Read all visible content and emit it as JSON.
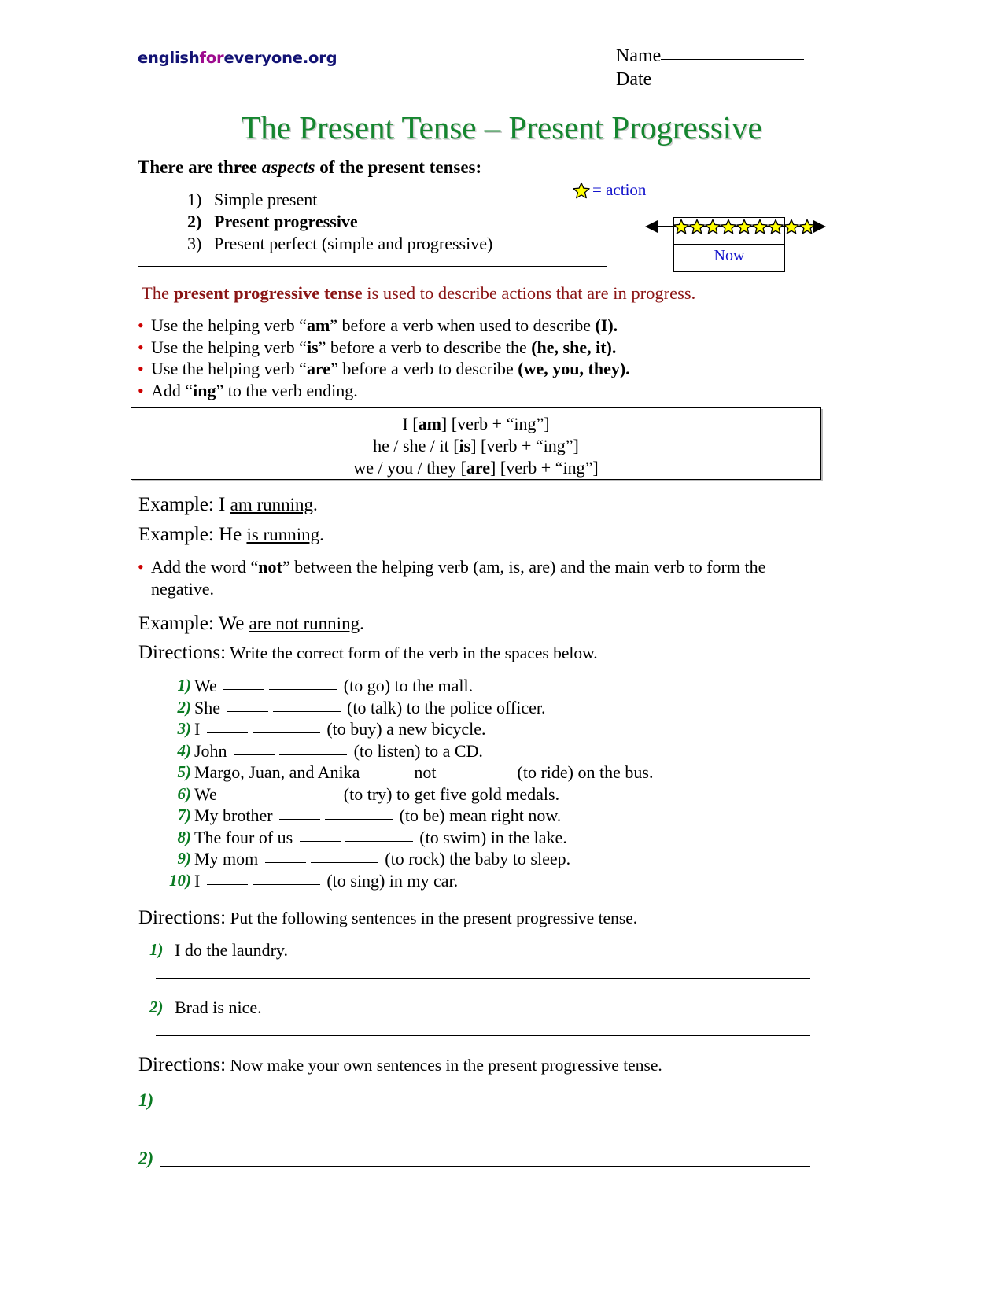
{
  "header": {
    "logo": {
      "part1": "english",
      "part2": "for",
      "part3": "everyone.org"
    },
    "name_label": "Name",
    "date_label": "Date"
  },
  "title": "The Present Tense – Present Progressive",
  "intro": {
    "heading_a": "There are three ",
    "heading_em": "aspects",
    "heading_b": " of the present tenses:",
    "aspects": [
      {
        "num": "1)",
        "label": "Simple present"
      },
      {
        "num": "2)",
        "label": "Present progressive"
      },
      {
        "num": "3)",
        "label": "Present perfect (simple and progressive)"
      }
    ]
  },
  "diagram": {
    "legend_text": "= action",
    "now_label": "Now",
    "star_count": 9,
    "star_color": "#ffff00",
    "legend_color": "#1414cc"
  },
  "rule_sentence": {
    "pre": "The ",
    "bold": "present progressive tense",
    "post": " is used to describe actions that are in progress.",
    "color": "#8a1414"
  },
  "bullets": [
    {
      "pre": "Use the helping verb “",
      "b1": "am",
      "mid": "” before a verb when used to describe ",
      "b2": "(I).",
      "post": ""
    },
    {
      "pre": "Use the helping verb “",
      "b1": "is",
      "mid": "” before a verb to describe the ",
      "b2": "(he, she, it).",
      "post": ""
    },
    {
      "pre": "Use the helping verb “",
      "b1": "are",
      "mid": "” before a verb to describe ",
      "b2": "(we, you, they).",
      "post": ""
    },
    {
      "pre": "Add “",
      "b1": "ing",
      "mid": "” to the verb ending.",
      "b2": "",
      "post": ""
    }
  ],
  "formula": {
    "line1_a": "I  [",
    "line1_b": "am",
    "line1_c": "] [verb + “ing”]",
    "line2_a": "he / she / it  [",
    "line2_b": "is",
    "line2_c": "] [verb + “ing”]",
    "line3_a": "we / you / they  [",
    "line3_b": "are",
    "line3_c": "] [verb + “ing”]"
  },
  "examples": {
    "ex1_lead": "Example: I ",
    "ex1_underline": "am running",
    "ex1_tail": ".",
    "ex2_lead": "Example: He ",
    "ex2_underline": "is running",
    "ex2_tail": ".",
    "ex3_lead": "Example: We ",
    "ex3_underline": "are not running",
    "ex3_tail": "."
  },
  "negative_bullet": {
    "pre": "Add the word “",
    "b1": "not",
    "post": "” between the helping verb (am, is, are) and the main verb to form the negative."
  },
  "directions": {
    "d1_word": "Directions:",
    "d1_rest": " Write the correct form of the verb in the spaces below.",
    "d2_word": "Directions:",
    "d2_rest": " Put the following sentences in the present progressive tense.",
    "d3_word": "Directions:",
    "d3_rest": " Now make your own sentences in the present progressive tense."
  },
  "exercise_items": [
    {
      "num": "1)",
      "pre": "We",
      "mid": "",
      "post": "(to go) to the mall."
    },
    {
      "num": "2)",
      "pre": "She",
      "mid": "",
      "post": "(to talk) to the police officer."
    },
    {
      "num": "3)",
      "pre": "I",
      "mid": "",
      "post": "(to buy) a new bicycle."
    },
    {
      "num": "4)",
      "pre": "John",
      "mid": "",
      "post": "(to listen) to a CD."
    },
    {
      "num": "5)",
      "pre": "Margo, Juan, and Anika",
      "mid": "not",
      "post": "(to ride) on the bus."
    },
    {
      "num": "6)",
      "pre": "We",
      "mid": "",
      "post": "(to try) to get five gold medals."
    },
    {
      "num": "7)",
      "pre": "My brother",
      "mid": "",
      "post": "(to be) mean right now."
    },
    {
      "num": "8)",
      "pre": "The four of us",
      "mid": "",
      "post": "(to swim) in the lake."
    },
    {
      "num": "9)",
      "pre": "My mom",
      "mid": "",
      "post": "(to rock) the baby to sleep."
    },
    {
      "num": "10)",
      "pre": "I",
      "mid": "",
      "post": "(to sing) in my car."
    }
  ],
  "rewrite_items": [
    {
      "num": "1)",
      "text": "I do the laundry."
    },
    {
      "num": "2)",
      "text": "Brad is nice."
    }
  ],
  "own_items": [
    {
      "num": "1)"
    },
    {
      "num": "2)"
    }
  ]
}
